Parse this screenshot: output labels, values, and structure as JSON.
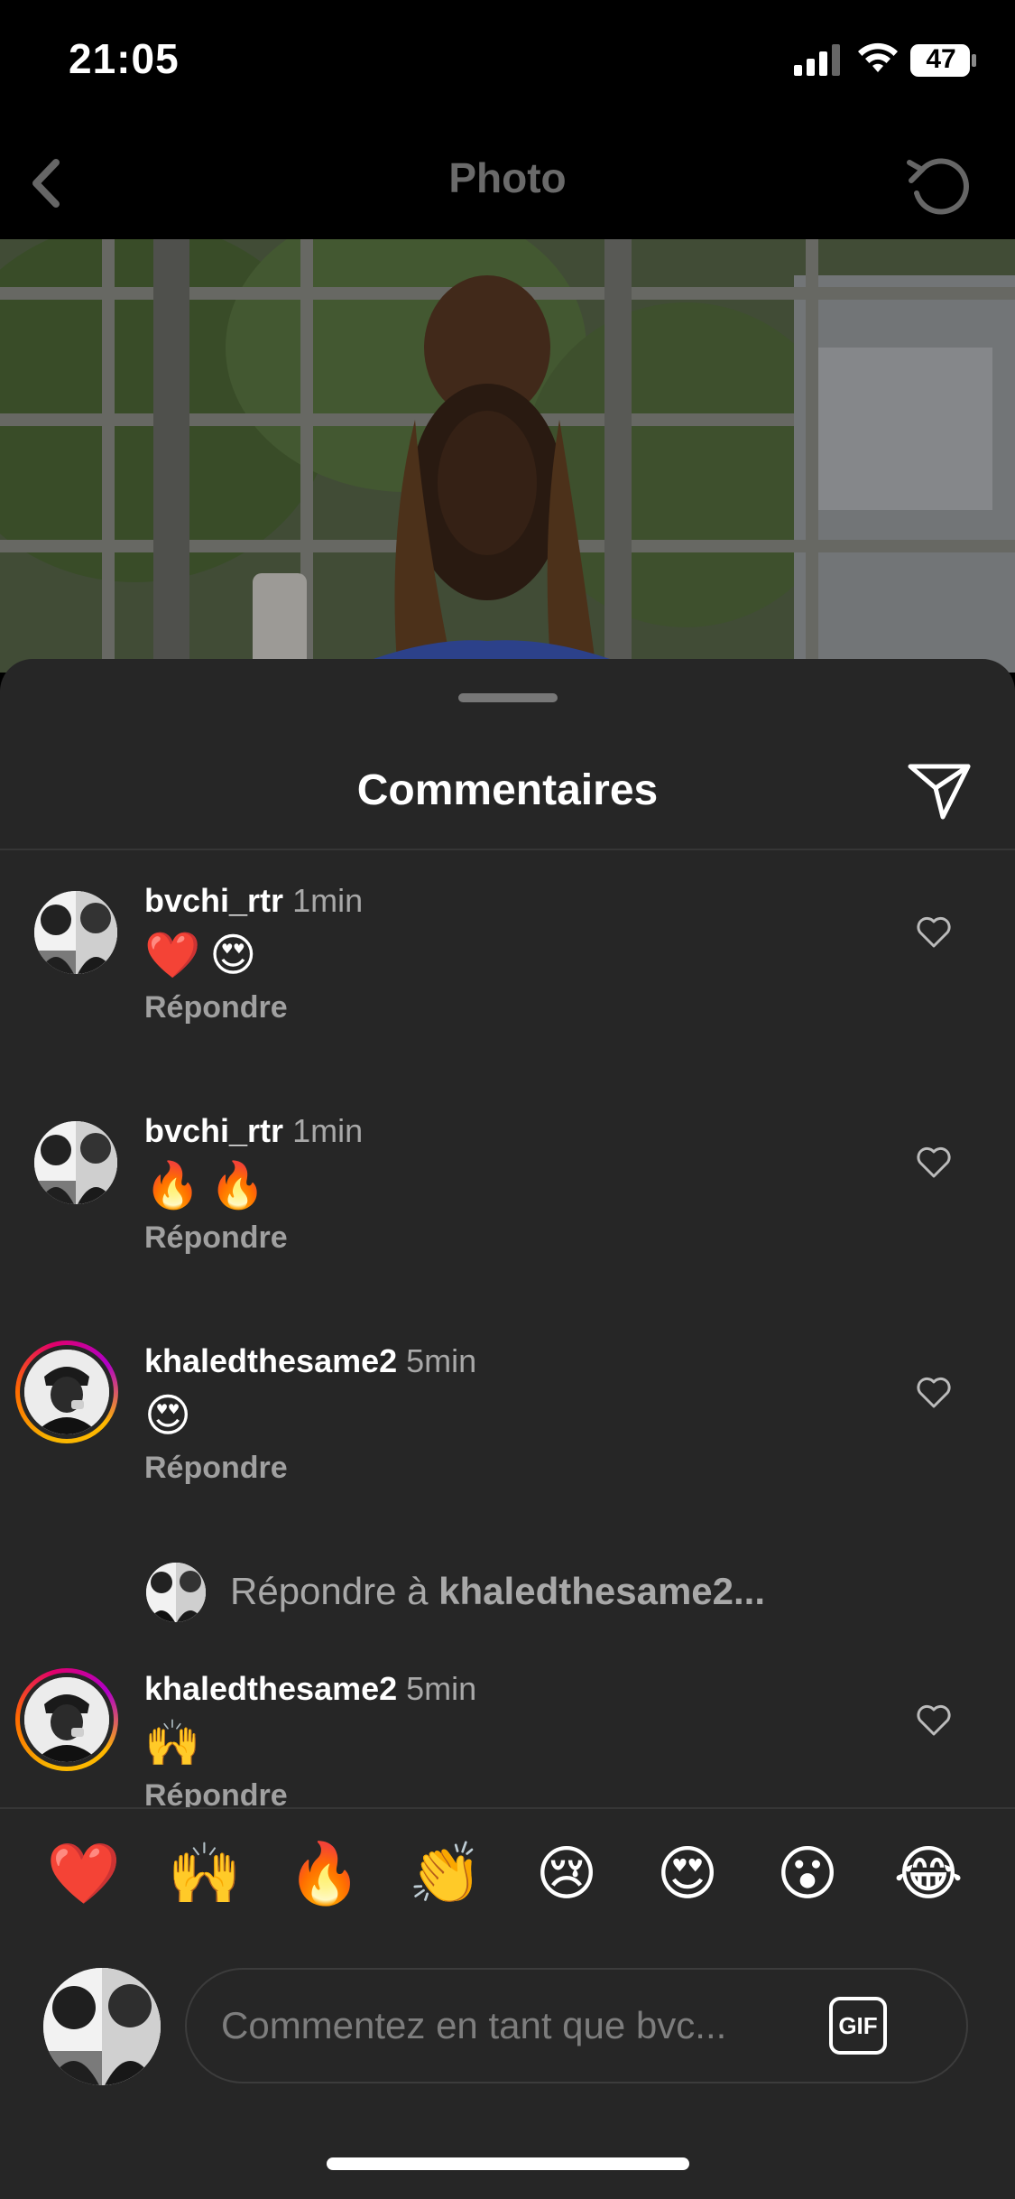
{
  "status_bar": {
    "time": "21:05",
    "battery": "47"
  },
  "nav": {
    "title": "Photo"
  },
  "sheet": {
    "title": "Commentaires"
  },
  "comments": [
    {
      "username": "bvchi_rtr",
      "time": "1min",
      "text": "❤️😍",
      "reply_label": "Répondre"
    },
    {
      "username": "bvchi_rtr",
      "time": "1min",
      "text": "🔥🔥",
      "reply_label": "Répondre"
    },
    {
      "username": "khaledthesame2",
      "time": "5min",
      "text": "😍",
      "reply_label": "Répondre"
    },
    {
      "username": "khaledthesame2",
      "time": "5min",
      "text": "🙌",
      "reply_label": "Répondre"
    }
  ],
  "reply_prompt": {
    "prefix": "Répondre à ",
    "username": "khaledthesame2..."
  },
  "emoji_bar": [
    "❤️",
    "🙌",
    "🔥",
    "👏",
    "😢",
    "😍",
    "😮",
    "😂"
  ],
  "composer": {
    "placeholder": "Commentez en tant que bvc...",
    "gif_label": "GIF"
  },
  "colors": {
    "sheet_bg": "#262626",
    "story_ring": "#e1006b",
    "muted_text": "#a8a8a8"
  }
}
